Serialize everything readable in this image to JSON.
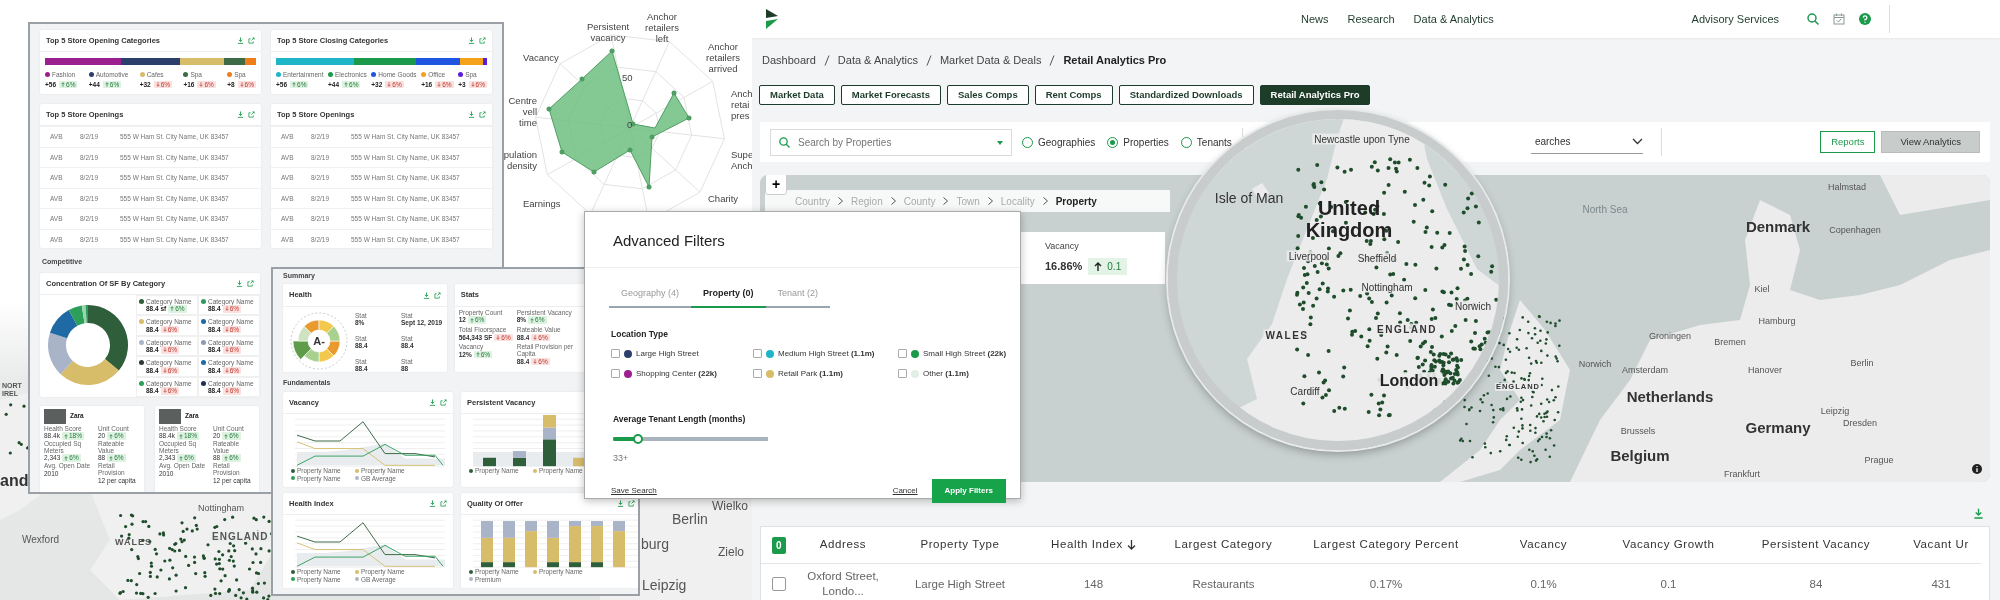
{
  "background_map": {
    "labels": [
      "and",
      "NORT IREL",
      "Wexford",
      "WALES",
      "ENGLAND",
      "Nottingham",
      "burg",
      "Berlin",
      "Wielko",
      "Zielo",
      "Leipzig"
    ]
  },
  "radar": {
    "labels": [
      [
        "Persistent",
        "vacancy"
      ],
      [
        "Anchor",
        "retailers",
        "left"
      ],
      [
        "Vacancy"
      ],
      [
        "Anchor",
        "retailers",
        "arrived"
      ],
      [
        "Centre",
        "vell time"
      ],
      [
        "Anch",
        "retai",
        "pres"
      ],
      [
        "pulation",
        "density"
      ],
      [
        "Supe",
        "Anch"
      ],
      [
        "Earnings"
      ],
      [
        "Charity"
      ]
    ],
    "ticks": [
      "50",
      "0"
    ]
  },
  "dashboard": {
    "category_cards": [
      {
        "title": "Top 5 Store Opening Categories",
        "items": [
          {
            "name": "Fashion",
            "count": "+56",
            "change": "6%",
            "rising": true,
            "color": "#9b1f8e"
          },
          {
            "name": "Automotive",
            "count": "+44",
            "change": "6%",
            "rising": true,
            "color": "#2c3e6b"
          },
          {
            "name": "Cafes",
            "count": "+32",
            "change": "6%",
            "rising": false,
            "color": "#d7bc6a"
          },
          {
            "name": "Spa",
            "count": "+16",
            "change": "6%",
            "rising": false,
            "color": "#3d6b45"
          },
          {
            "name": "Spa",
            "count": "+8",
            "change": "6%",
            "rising": false,
            "color": "#f07d1a"
          }
        ]
      },
      {
        "title": "Top 5 Store Closing Categories",
        "items": [
          {
            "name": "Entertainment",
            "count": "+56",
            "change": "6%",
            "rising": true,
            "color": "#1fb5c9"
          },
          {
            "name": "Electronics",
            "count": "+44",
            "change": "6%",
            "rising": true,
            "color": "#1a9a4a"
          },
          {
            "name": "Home Goods",
            "count": "+32",
            "change": "6%",
            "rising": false,
            "color": "#1f55e0"
          },
          {
            "name": "Office",
            "count": "+16",
            "change": "6%",
            "rising": false,
            "color": "#f5a21a"
          },
          {
            "name": "Spa",
            "count": "+3",
            "change": "6%",
            "rising": false,
            "color": "#5a1fd6"
          }
        ]
      }
    ],
    "openings_cards": [
      {
        "title": "Top 5 Store Openings",
        "rows": [
          [
            "AVB",
            "8/2/19",
            "555 W Ham St. City Name, UK 83457"
          ],
          [
            "AVB",
            "8/2/19",
            "555 W Ham St. City Name, UK 83457"
          ],
          [
            "AVB",
            "8/2/19",
            "555 W Ham St. City Name, UK 83457"
          ],
          [
            "AVB",
            "8/2/19",
            "555 W Ham St. City Name, UK 83457"
          ],
          [
            "AVB",
            "8/2/19",
            "555 W Ham St. City Name, UK 83457"
          ],
          [
            "AVB",
            "8/2/19",
            "555 W Ham St. City Name, UK 83457"
          ]
        ]
      },
      {
        "title": "Top 5 Store Openings",
        "rows": [
          [
            "AVB",
            "8/2/19",
            "555 W Ham St. City Name, UK 83457"
          ],
          [
            "AVB",
            "8/2/19",
            "555 W Ham St. City Name, UK 83457"
          ],
          [
            "AVB",
            "8/2/19",
            "555 W Ham St. City Name, UK 83457"
          ],
          [
            "AVB",
            "8/2/19",
            "555 W Ham St. City Name, UK 83457"
          ],
          [
            "AVB",
            "8/2/19",
            "555 W Ham St. City Name, UK 83457"
          ],
          [
            "AVB",
            "8/2/19",
            "555 W Ham St. City Name, UK 83457"
          ]
        ]
      }
    ],
    "section": "Competitive",
    "concentration": {
      "title": "Concentration Of SF By Category",
      "items": [
        {
          "name": "Category Name",
          "value": "88.4 sf",
          "change": "6%",
          "rising": true,
          "color": "#2f5e3a"
        },
        {
          "name": "Category Name",
          "value": "88.4",
          "change": "6%",
          "rising": false,
          "color": "#2e9e5b"
        },
        {
          "name": "Category Name",
          "value": "88.4",
          "change": "6%",
          "rising": false,
          "color": "#d7bc6a"
        },
        {
          "name": "Category Name",
          "value": "88.4",
          "change": "6%",
          "rising": false,
          "color": "#1f6aa5"
        },
        {
          "name": "Category Name",
          "value": "88.4",
          "change": "6%",
          "rising": false,
          "color": "#aab4c8"
        },
        {
          "name": "Category Name",
          "value": "88.4",
          "change": "6%",
          "rising": false,
          "color": "#8f9bb3"
        },
        {
          "name": "Category Name",
          "value": "88.4",
          "change": "6%",
          "rising": false,
          "color": "#2f3a33"
        },
        {
          "name": "Category Name",
          "value": "88.4",
          "change": "6%",
          "rising": false,
          "color": "#1f6aa5"
        },
        {
          "name": "Category Name",
          "value": "88.4",
          "change": "6%",
          "rising": false,
          "color": "#2e9e5b"
        },
        {
          "name": "Category Name",
          "value": "88.4",
          "change": "6%",
          "rising": false,
          "color": "#1d2f55"
        }
      ]
    },
    "stores": [
      {
        "name": "Zara",
        "stats": [
          {
            "label": "Health Score",
            "value": "88.4k",
            "change": "18%",
            "rising": true
          },
          {
            "label": "Unit Count",
            "value": "20",
            "change": "6%",
            "rising": true
          },
          {
            "label": "Occupied Sq Meters",
            "value": "2,343",
            "change": "6%",
            "rising": true
          },
          {
            "label": "Rateable Value",
            "value": "88",
            "change": "6%",
            "rising": true
          },
          {
            "label": "Avg. Open Date",
            "value": "2010"
          },
          {
            "label": "Retail Provision",
            "value": "12 per capita"
          }
        ]
      },
      {
        "name": "Zara",
        "stats": [
          {
            "label": "Health Score",
            "value": "88.4k",
            "change": "18%",
            "rising": true
          },
          {
            "label": "Unit Count",
            "value": "20",
            "change": "6%",
            "rising": true
          },
          {
            "label": "Occupied Sq Meters",
            "value": "2,343",
            "change": "6%",
            "rising": true
          },
          {
            "label": "Rateable Value",
            "value": "88",
            "change": "6%",
            "rising": true
          },
          {
            "label": "Avg. Open Date",
            "value": "2010"
          },
          {
            "label": "Retail Provision",
            "value": "12 per capita"
          }
        ]
      }
    ]
  },
  "summary": {
    "title": "Summary",
    "health": {
      "title": "Health",
      "grade": "A-",
      "stats": [
        {
          "label": "Stat",
          "value": "8%"
        },
        {
          "label": "Stat",
          "value": "Sept 12, 2019"
        },
        {
          "label": "Stat",
          "value": "88.4"
        },
        {
          "label": "Stat",
          "value": "88.4"
        },
        {
          "label": "Stat",
          "value": "88.4"
        },
        {
          "label": "Stat",
          "value": "88"
        }
      ]
    },
    "stats": {
      "title": "Stats",
      "items": [
        {
          "label": "Property Count",
          "value": "12",
          "change": "6%",
          "rising": true
        },
        {
          "label": "Persistent Vacancy",
          "value": "8%",
          "change": "6%",
          "rising": true
        },
        {
          "label": "Total Floorspace",
          "value": "564,343 SF",
          "change": "6%",
          "rising": false
        },
        {
          "label": "Rateable Value",
          "value": "88.4",
          "change": "6%",
          "rising": false
        },
        {
          "label": "Vacancy",
          "value": "12%",
          "change": "6%",
          "rising": true
        },
        {
          "label": "Retail Provision per Capita",
          "value": "88.4",
          "change": "6%",
          "rising": false
        }
      ]
    },
    "section": "Fundamentals",
    "charts": [
      {
        "title": "Vacancy",
        "kind": "line",
        "legend": [
          {
            "name": "Property Name",
            "color": "#2f5e3a"
          },
          {
            "name": "Property Name",
            "color": "#d7bc6a"
          },
          {
            "name": "Property Name",
            "color": "#2e9e5b"
          },
          {
            "name": "GB Average",
            "color": "#b0b8c0"
          }
        ]
      },
      {
        "title": "Persistent Vacancy",
        "kind": "bars",
        "legend": [
          {
            "name": "Property Name",
            "color": "#2f5e3a"
          },
          {
            "name": "Property Name",
            "color": "#d7bc6a"
          }
        ]
      },
      {
        "title": "Health Index",
        "kind": "line",
        "legend": [
          {
            "name": "Property Name",
            "color": "#2f5e3a"
          },
          {
            "name": "Property Name",
            "color": "#d7bc6a"
          },
          {
            "name": "Property Name",
            "color": "#2e9e5b"
          },
          {
            "name": "GB Average",
            "color": "#b0b8c0"
          }
        ]
      },
      {
        "title": "Quality Of Offer",
        "kind": "stacked",
        "legend": [
          {
            "name": "Property Name",
            "color": "#2f5e3a"
          },
          {
            "name": "Property Name",
            "color": "#d7bc6a"
          },
          {
            "name": "Premium",
            "color": "#b0b8c0"
          }
        ]
      }
    ]
  },
  "app": {
    "nav": {
      "items": [
        "News",
        "Research",
        "Data & Analytics"
      ],
      "right": "Advisory Services"
    },
    "breadcrumb": [
      "Dashboard",
      "Data & Analytics",
      "Market Data & Deals",
      "Retail Analytics Pro"
    ],
    "tabs": [
      {
        "label": "Market Data",
        "selected": false
      },
      {
        "label": "Market Forecasts",
        "selected": false
      },
      {
        "label": "Sales Comps",
        "selected": false
      },
      {
        "label": "Rent Comps",
        "selected": false
      },
      {
        "label": "Standardized Downloads",
        "selected": false
      },
      {
        "label": "Retail Analytics Pro",
        "selected": true
      }
    ],
    "search": {
      "placeholder": "Search by Properties"
    },
    "scope": [
      {
        "label": "Geographies",
        "selected": false
      },
      {
        "label": "Properties",
        "selected": true
      },
      {
        "label": "Tenants",
        "selected": false
      }
    ],
    "saved_search": {
      "value": "earches"
    },
    "buttons": [
      {
        "label": "Reports",
        "kind": "outline"
      },
      {
        "label": "View Analytics",
        "kind": "filled"
      }
    ],
    "map": {
      "zoom": "+",
      "path": [
        {
          "label": "Country",
          "current": false
        },
        {
          "label": "Region",
          "current": false
        },
        {
          "label": "County",
          "current": false
        },
        {
          "label": "Town",
          "current": false
        },
        {
          "label": "Locality",
          "current": false
        },
        {
          "label": "Property",
          "current": true
        }
      ],
      "info": {
        "label": "Vacancy",
        "value": "16.86%",
        "change": "0.1",
        "rising": true
      },
      "labels": [
        {
          "text": "Halmstad",
          "kind": "city"
        },
        {
          "text": "North Sea",
          "kind": "sea"
        },
        {
          "text": "Denmark",
          "kind": "country"
        },
        {
          "text": "Copenhagen",
          "kind": "city"
        },
        {
          "text": "Kiel",
          "kind": "city"
        },
        {
          "text": "Hamburg",
          "kind": "city"
        },
        {
          "text": "Groningen",
          "kind": "city"
        },
        {
          "text": "Bremen",
          "kind": "city"
        },
        {
          "text": "Norwich",
          "kind": "city"
        },
        {
          "text": "Amsterdam",
          "kind": "city"
        },
        {
          "text": "Hanover",
          "kind": "city"
        },
        {
          "text": "Berlin",
          "kind": "city"
        },
        {
          "text": "ENGLAND",
          "kind": "region"
        },
        {
          "text": "Netherlands",
          "kind": "country"
        },
        {
          "text": "Leipzig",
          "kind": "city"
        },
        {
          "text": "Brussels",
          "kind": "city"
        },
        {
          "text": "Germany",
          "kind": "country"
        },
        {
          "text": "Dresden",
          "kind": "city"
        },
        {
          "text": "Belgium",
          "kind": "country"
        },
        {
          "text": "Prague",
          "kind": "city"
        },
        {
          "text": "Frankfurt",
          "kind": "city"
        }
      ],
      "magnifier_labels": [
        {
          "text": "Newcastle upon Tyne",
          "kind": "city"
        },
        {
          "text": "Isle of Man",
          "kind": "island"
        },
        {
          "text": "United Kingdom",
          "kind": "country"
        },
        {
          "text": "Liverpool",
          "kind": "city"
        },
        {
          "text": "Sheffield",
          "kind": "city"
        },
        {
          "text": "Nottingham",
          "kind": "city"
        },
        {
          "text": "Norwich",
          "kind": "city"
        },
        {
          "text": "WALES",
          "kind": "region"
        },
        {
          "text": "ENGLAND",
          "kind": "region"
        },
        {
          "text": "Cardiff",
          "kind": "city"
        },
        {
          "text": "London",
          "kind": "capital"
        }
      ]
    },
    "table": {
      "selected_count": "0",
      "columns": [
        {
          "label": "Address",
          "sorted": false
        },
        {
          "label": "Property Type",
          "sorted": false
        },
        {
          "label": "Health Index",
          "sorted": true
        },
        {
          "label": "Largest Category",
          "sorted": false
        },
        {
          "label": "Largest Category Percent",
          "sorted": false
        },
        {
          "label": "Vacancy",
          "sorted": false
        },
        {
          "label": "Vacancy Growth",
          "sorted": false
        },
        {
          "label": "Persistent Vacancy",
          "sorted": false
        },
        {
          "label": "Vacant Ur",
          "sorted": false
        }
      ],
      "rows": [
        {
          "checked": false,
          "cells": [
            "Oxford Street, Londo...",
            "Large High Street",
            "148",
            "Restaurants",
            "0.17%",
            "0.1%",
            "0.1",
            "84",
            "431"
          ]
        }
      ]
    }
  },
  "filters": {
    "title": "Advanced Filters",
    "tabs": [
      {
        "label": "Geography (4)",
        "selected": false
      },
      {
        "label": "Property (0)",
        "selected": true
      },
      {
        "label": "Tenant (2)",
        "selected": false
      }
    ],
    "section": "Location Type",
    "options": [
      {
        "label": "Large High Street",
        "checked": false,
        "color": "#2c3e6b"
      },
      {
        "label": "Medium High Street **(1.1m)**",
        "checked": false,
        "color": "#1fb5c9"
      },
      {
        "label": "Small High Street **(22k)**",
        "checked": false,
        "color": "#1a9a4a"
      },
      {
        "label": "Shopping Center **(22k)**",
        "checked": false,
        "color": "#9b1f8e"
      },
      {
        "label": "Retail Park **(1.1m)**",
        "checked": false,
        "color": "#d7bc6a"
      },
      {
        "label": "Other **(1.1m)**",
        "checked": false,
        "color": "#e3eee6"
      }
    ],
    "slider": {
      "label": "Average Tenant Length (months)",
      "level": 0.16,
      "reading": "33+"
    },
    "save": "Save Search",
    "cancel": "Cancel",
    "apply": "Apply Filters"
  }
}
